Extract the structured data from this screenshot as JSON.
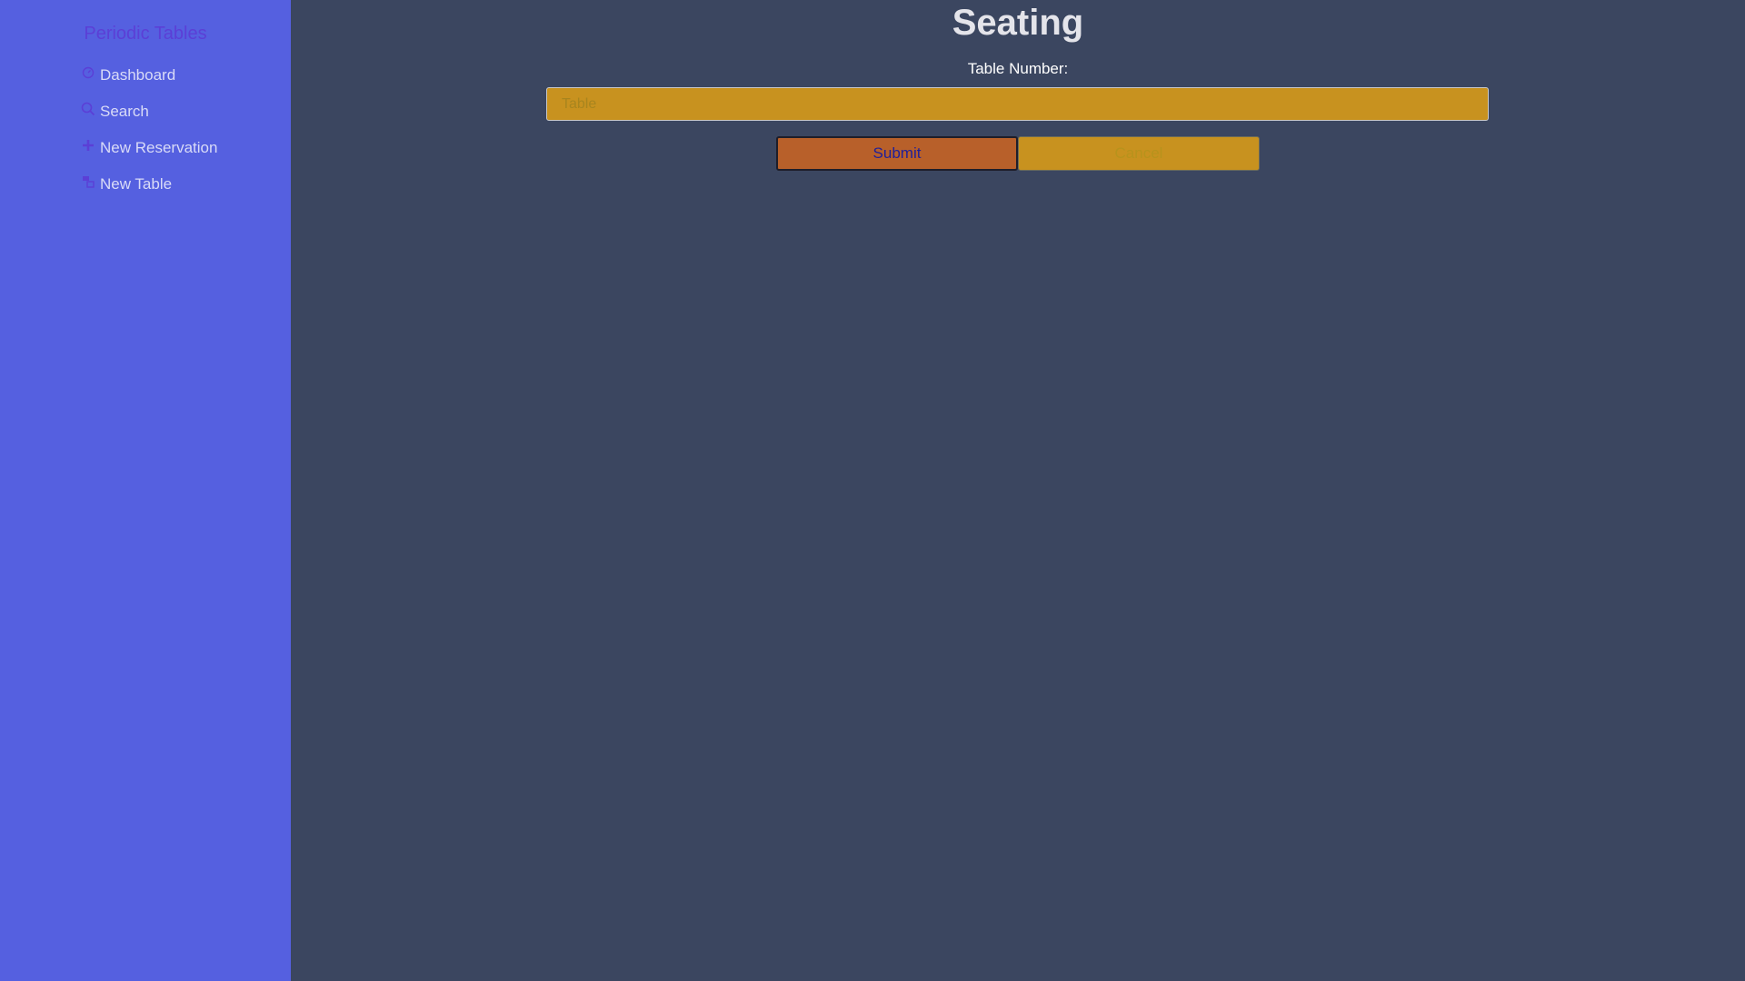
{
  "sidebar": {
    "brand": "Periodic Tables",
    "items": [
      {
        "label": "Dashboard",
        "icon": "dashboard-icon"
      },
      {
        "label": "Search",
        "icon": "search-icon"
      },
      {
        "label": "New Reservation",
        "icon": "plus-icon"
      },
      {
        "label": "New Table",
        "icon": "table-icon"
      }
    ]
  },
  "main": {
    "title": "Seating",
    "table_label": "Table Number:",
    "table_placeholder": "Table",
    "submit_label": "Submit",
    "cancel_label": "Cancel"
  },
  "colors": {
    "sidebar_bg": "#5560e0",
    "main_bg": "#3b4660",
    "brand": "#5b3fd6",
    "input_bg": "#c8921f",
    "submit_bg": "#b8602a"
  }
}
